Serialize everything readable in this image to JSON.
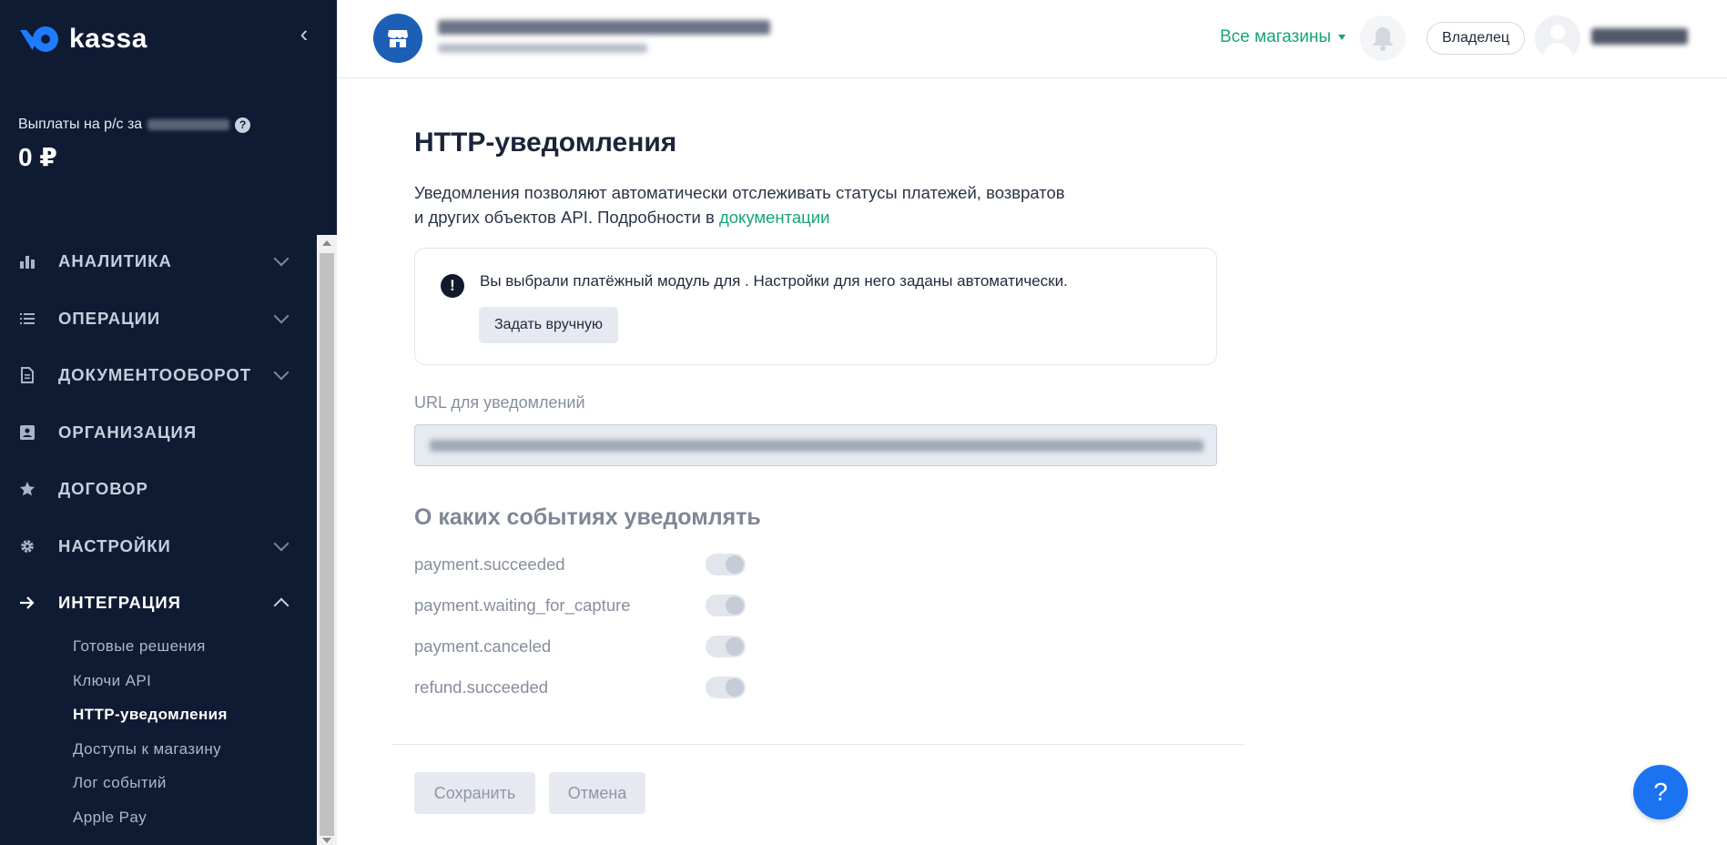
{
  "app": {
    "logo_text": "kassa"
  },
  "sidebar": {
    "payout_label": "Выплаты на р/с за",
    "payout_value": "0 ₽",
    "nav": [
      {
        "label": "АНАЛИТИКА",
        "icon": "bar-chart-icon"
      },
      {
        "label": "ОПЕРАЦИИ",
        "icon": "list-icon"
      },
      {
        "label": "ДОКУМЕНТООБОРОТ",
        "icon": "document-icon"
      },
      {
        "label": "ОРГАНИЗАЦИЯ",
        "icon": "id-card-icon"
      },
      {
        "label": "ДОГОВОР",
        "icon": "star-icon"
      },
      {
        "label": "НАСТРОЙКИ",
        "icon": "gear-icon"
      },
      {
        "label": "ИНТЕГРАЦИЯ",
        "icon": "arrow-right-icon"
      }
    ],
    "subnav": [
      {
        "label": "Готовые решения"
      },
      {
        "label": "Ключи API"
      },
      {
        "label": "HTTP-уведомления"
      },
      {
        "label": "Доступы к магазину"
      },
      {
        "label": "Лог событий"
      },
      {
        "label": "Apple Pay"
      }
    ]
  },
  "header": {
    "all_shops": "Все магазины",
    "role": "Владелец"
  },
  "page": {
    "title": "HTTP-уведомления",
    "desc_line1": "Уведомления позволяют автоматически отслеживать статусы платежей, возвратов",
    "desc_line2": "и других объектов API. Подробности в ",
    "desc_link": "документации",
    "notice_icon": "!",
    "notice_text": "Вы выбрали платёжный модуль для . Настройки для него заданы автоматически.",
    "manual_button": "Задать вручную",
    "url_label": "URL для уведомлений",
    "events_title": "О каких событиях уведомлять",
    "events": [
      {
        "name": "payment.succeeded",
        "enabled": true
      },
      {
        "name": "payment.waiting_for_capture",
        "enabled": true
      },
      {
        "name": "payment.canceled",
        "enabled": true
      },
      {
        "name": "refund.succeeded",
        "enabled": true
      }
    ],
    "save_button": "Сохранить",
    "cancel_button": "Отмена"
  },
  "help_fab": "?",
  "colors": {
    "sidebar_bg": "#0f1b33",
    "accent_green": "#1aa37a",
    "brand_blue": "#1f7bff",
    "fab_blue": "#1b73f2"
  }
}
